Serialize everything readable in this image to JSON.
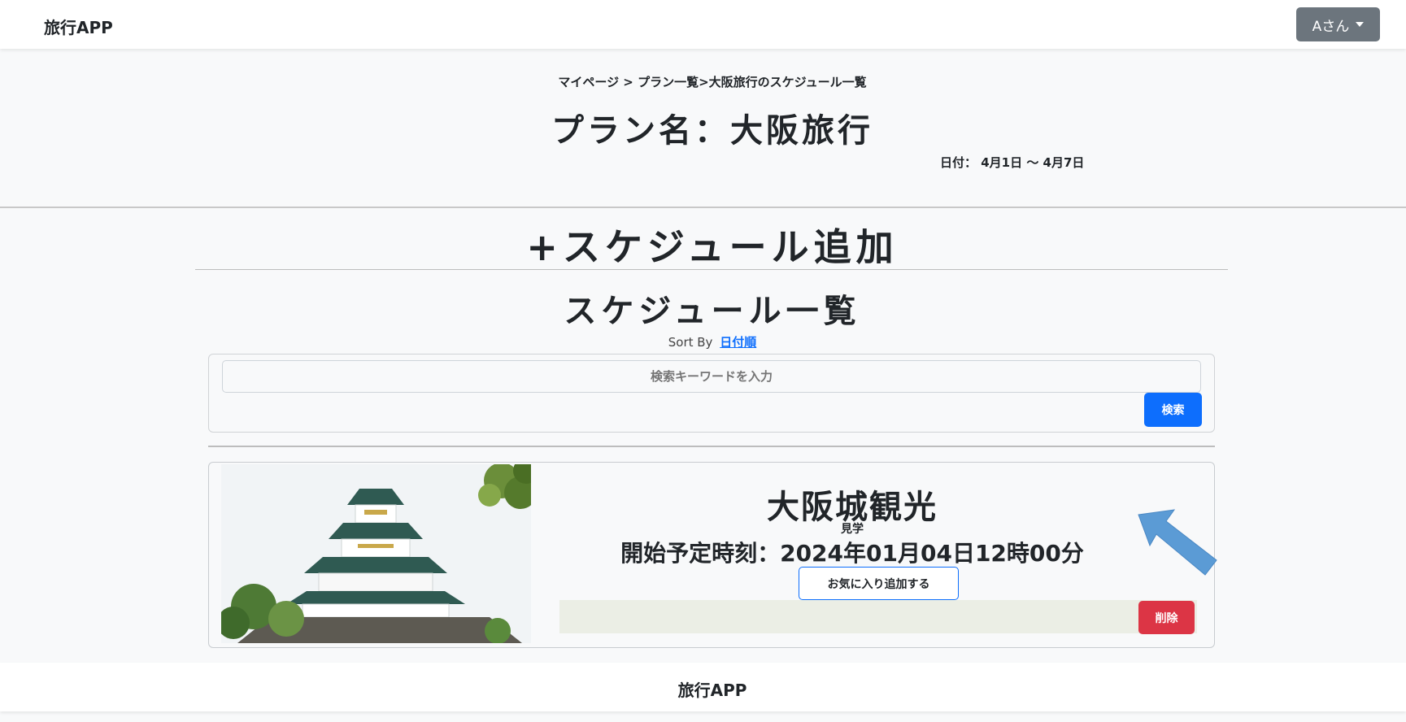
{
  "navbar": {
    "brand": "旅行APP",
    "user_menu_label": "Aさん"
  },
  "header": {
    "breadcrumb": "マイページ > プラン一覧>大阪旅行のスケジュール一覧",
    "plan_title": "プラン名：大阪旅行",
    "date_range": "日付： 4月1日 ～ 4月7日"
  },
  "schedule": {
    "add_label": "+スケジュール追加",
    "list_title": "スケジュール一覧",
    "sort_prefix": "Sort By",
    "sort_link": "日付順"
  },
  "search": {
    "placeholder": "検索キーワードを入力",
    "button_label": "検索"
  },
  "cards": [
    {
      "image": "osaka-castle-photo",
      "title": "大阪城観光",
      "category": "見学",
      "start_time": "開始予定時刻：2024年01月04日12時00分",
      "favorite_label": "お気に入り追加する",
      "delete_label": "削除"
    }
  ],
  "footer": {
    "brand": "旅行APP"
  },
  "colors": {
    "primary": "#0d6efd",
    "danger": "#dc3545",
    "secondary": "#6c757d",
    "annotation_arrow": "#5b9bd5"
  }
}
